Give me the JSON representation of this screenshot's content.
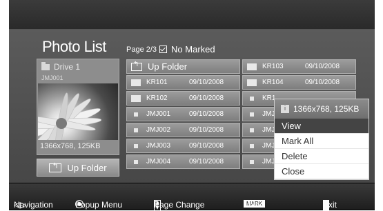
{
  "title": "Photo List",
  "page_info": {
    "page_label": "Page 2/3",
    "marked_text": "No Marked"
  },
  "preview": {
    "drive_label": "Drive 1",
    "file_name": "JMJ001",
    "resolution": "1366x768, 125KB"
  },
  "up_folder_button": "Up Folder",
  "files_col1": [
    {
      "name": "Up Folder",
      "date": "",
      "kind": "up"
    },
    {
      "name": "KR101",
      "date": "09/10/2008",
      "kind": "folder"
    },
    {
      "name": "KR102",
      "date": "09/10/2008",
      "kind": "folder"
    },
    {
      "name": "JMJ001",
      "date": "09/10/2008",
      "kind": "file"
    },
    {
      "name": "JMJ002",
      "date": "09/10/2008",
      "kind": "file"
    },
    {
      "name": "JMJ003",
      "date": "09/10/2008",
      "kind": "file"
    },
    {
      "name": "JMJ004",
      "date": "09/10/2008",
      "kind": "file"
    }
  ],
  "files_col2": [
    {
      "name": "KR103",
      "date": "09/10/2008",
      "kind": "folder"
    },
    {
      "name": "KR104",
      "date": "09/10/2008",
      "kind": "folder"
    },
    {
      "name": "KR1",
      "date": "",
      "kind": "file"
    },
    {
      "name": "JMJ",
      "date": "",
      "kind": "file"
    },
    {
      "name": "JMJ",
      "date": "",
      "kind": "file"
    },
    {
      "name": "JMJ",
      "date": "",
      "kind": "file"
    },
    {
      "name": "JMJ",
      "date": "",
      "kind": "file"
    }
  ],
  "popup": {
    "header": "1366x768, 125KB",
    "items": [
      "View",
      "Mark All",
      "Delete",
      "Close"
    ],
    "selected_index": 0
  },
  "help_bar": {
    "navigation": "Navigation",
    "popup_menu": "Popup Menu",
    "p_label": "P",
    "page_change": "Page Change",
    "mark_badge": "MARK",
    "mark": "Mark",
    "exit": "Exit"
  }
}
